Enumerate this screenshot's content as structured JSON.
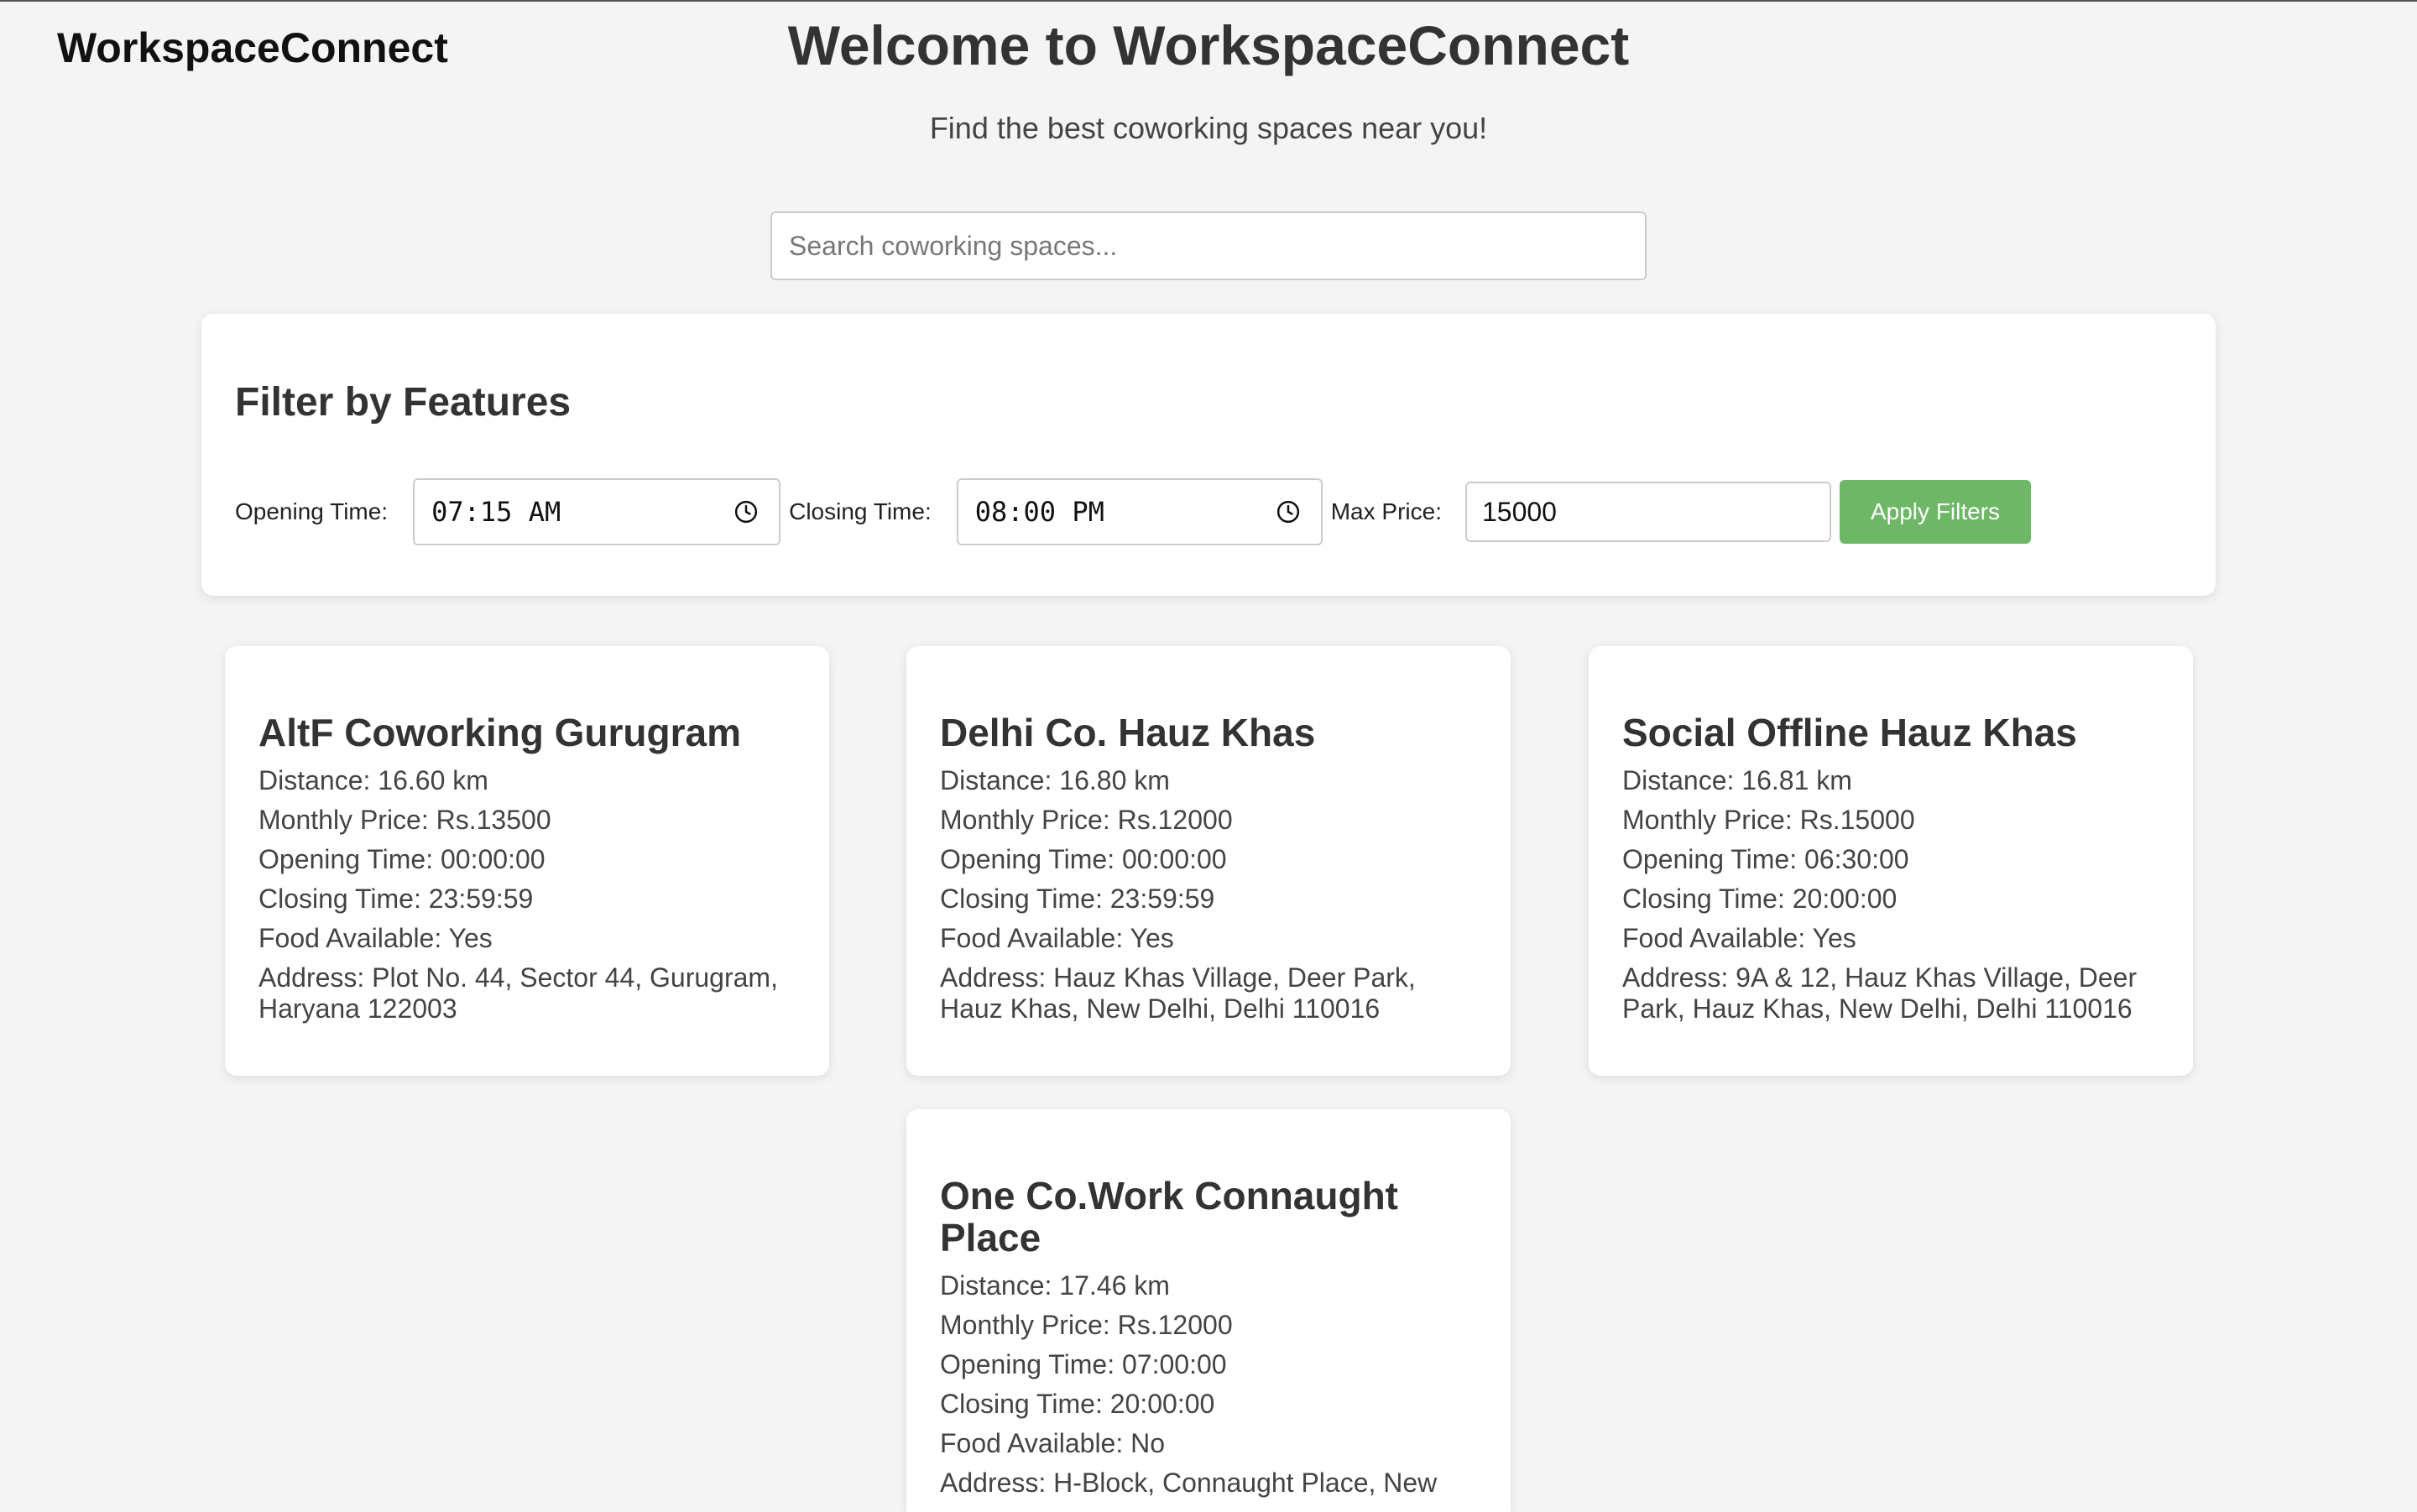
{
  "app": {
    "brand": "WorkspaceConnect"
  },
  "hero": {
    "title": "Welcome to WorkspaceConnect",
    "subtitle": "Find the best coworking spaces near you!"
  },
  "search": {
    "placeholder": "Search coworking spaces...",
    "value": ""
  },
  "filters": {
    "heading": "Filter by Features",
    "opening_label": "Opening Time:",
    "opening_value": "07:15 AM",
    "closing_label": "Closing Time:",
    "closing_value": "08:00 PM",
    "max_price_label": "Max Price:",
    "max_price_value": "15000",
    "apply_label": "Apply Filters",
    "apply_color": "#6db766"
  },
  "spaces": [
    {
      "name": "AltF Coworking Gurugram",
      "distance": "Distance: 16.60 km",
      "price": "Monthly Price: Rs.13500",
      "opening": "Opening Time: 00:00:00",
      "closing": "Closing Time: 23:59:59",
      "food": "Food Available: Yes",
      "address": "Address: Plot No. 44, Sector 44, Gurugram, Haryana 122003"
    },
    {
      "name": "Delhi Co. Hauz Khas",
      "distance": "Distance: 16.80 km",
      "price": "Monthly Price: Rs.12000",
      "opening": "Opening Time: 00:00:00",
      "closing": "Closing Time: 23:59:59",
      "food": "Food Available: Yes",
      "address": "Address: Hauz Khas Village, Deer Park, Hauz Khas, New Delhi, Delhi 110016"
    },
    {
      "name": "Social Offline Hauz Khas",
      "distance": "Distance: 16.81 km",
      "price": "Monthly Price: Rs.15000",
      "opening": "Opening Time: 06:30:00",
      "closing": "Closing Time: 20:00:00",
      "food": "Food Available: Yes",
      "address": "Address: 9A & 12, Hauz Khas Village, Deer Park, Hauz Khas, New Delhi, Delhi 110016"
    },
    {
      "name": "One Co.Work Connaught Place",
      "distance": "Distance: 17.46 km",
      "price": "Monthly Price: Rs.12000",
      "opening": "Opening Time: 07:00:00",
      "closing": "Closing Time: 20:00:00",
      "food": "Food Available: No",
      "address": "Address: H-Block, Connaught Place, New"
    }
  ],
  "icons": {
    "opening_time": "clock-icon",
    "closing_time": "clock-icon"
  }
}
